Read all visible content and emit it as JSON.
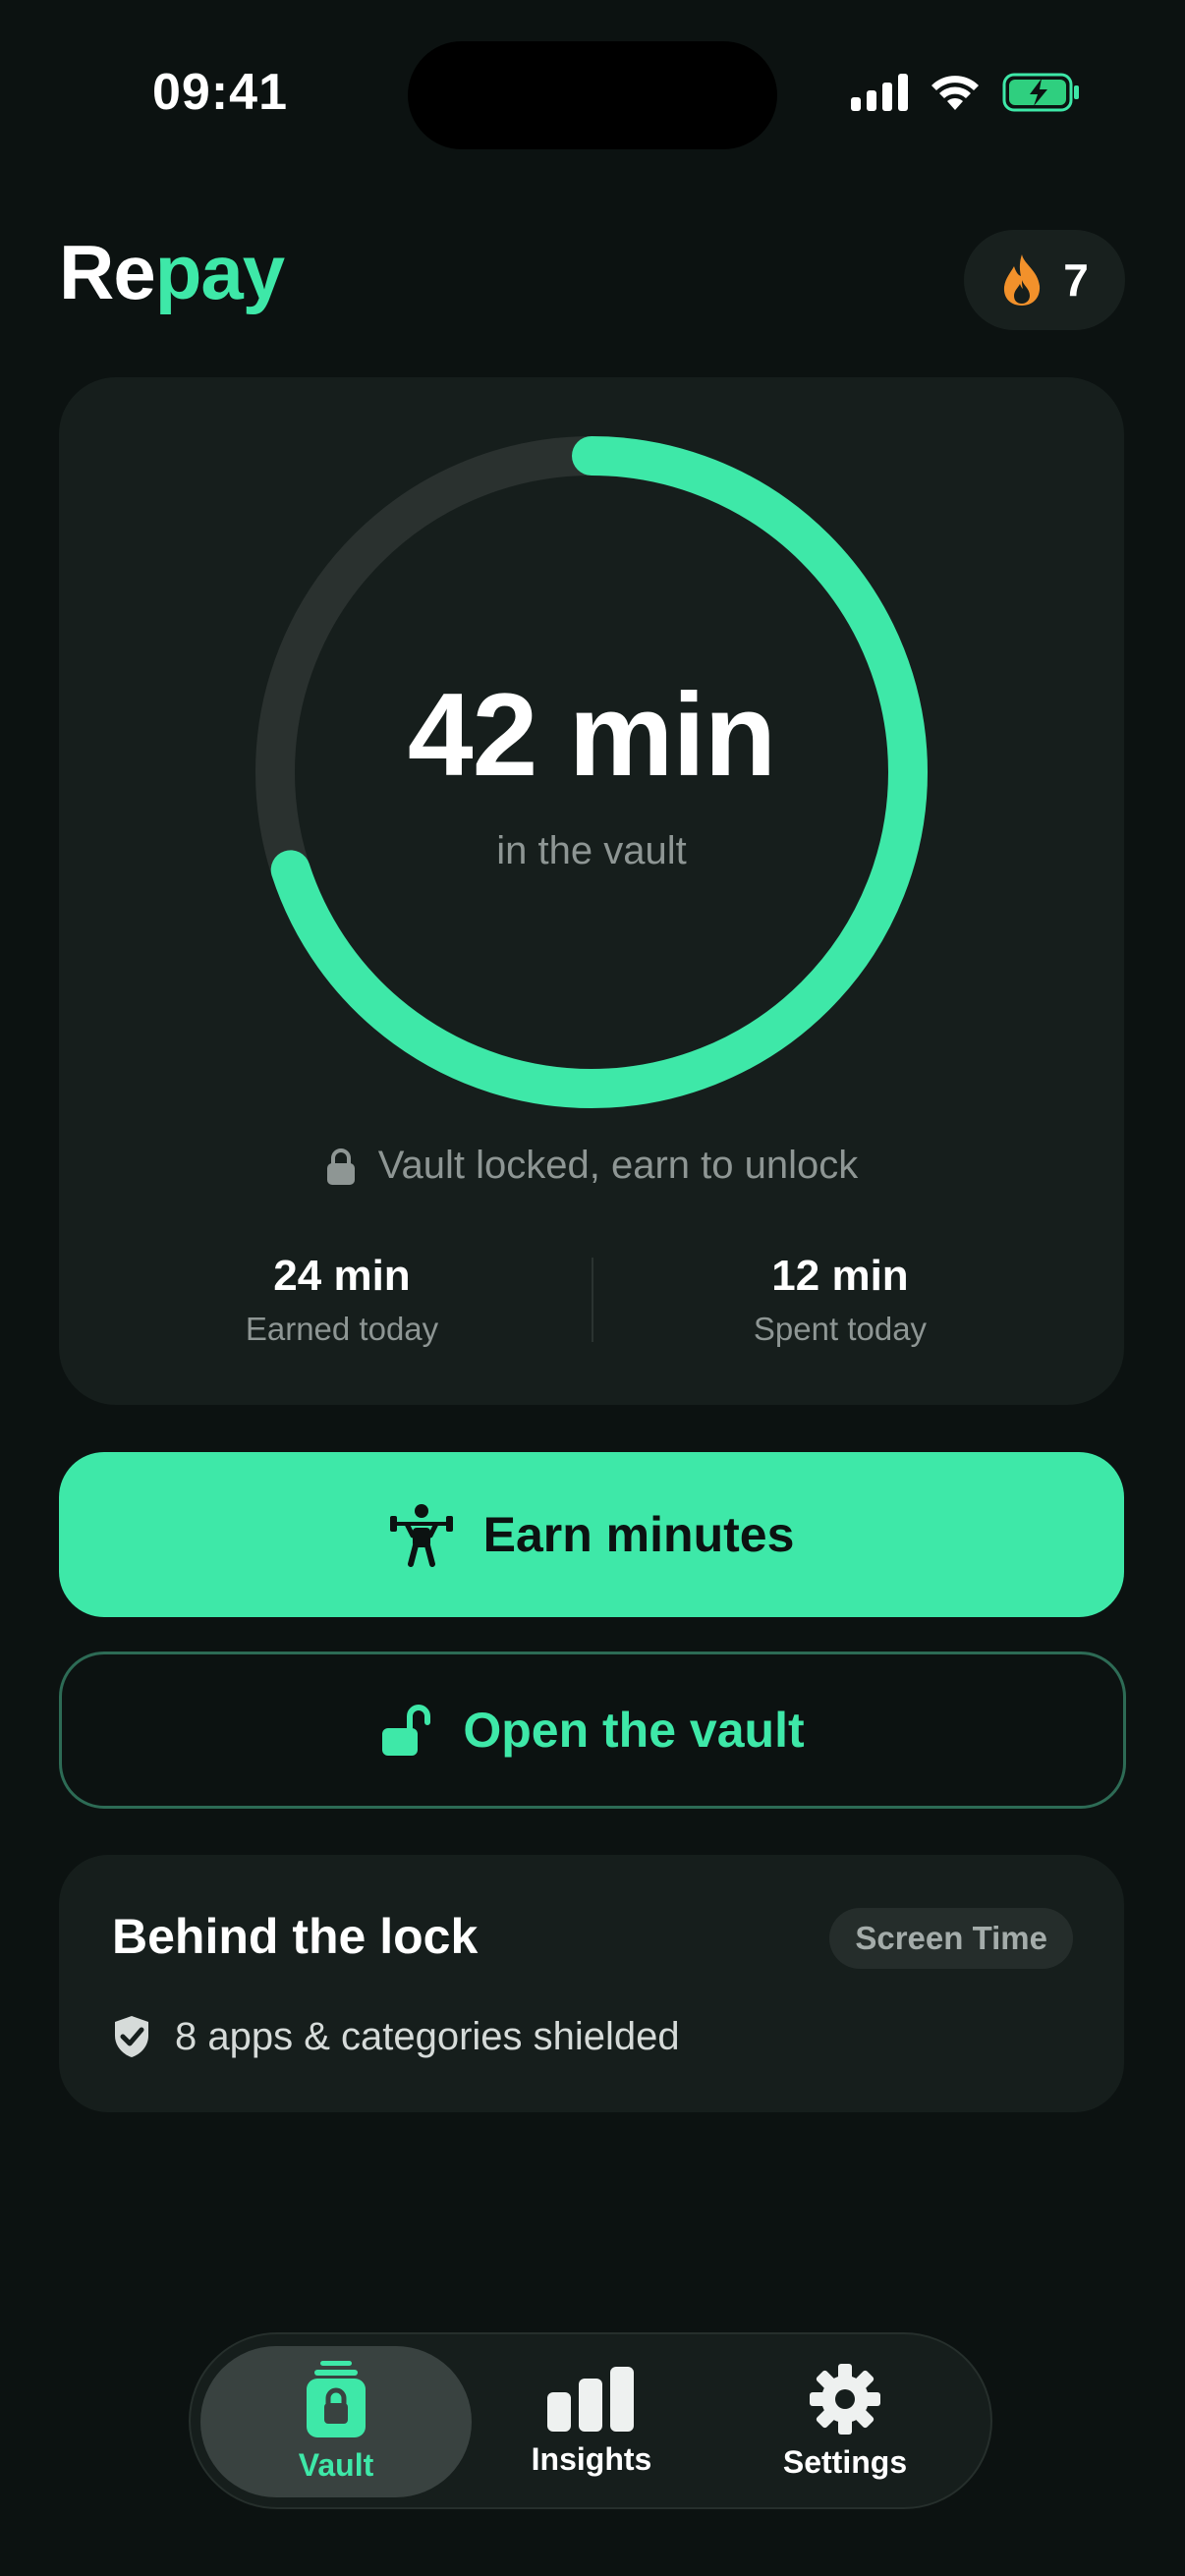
{
  "status_bar": {
    "time": "09:41"
  },
  "header": {
    "logo_part1": "Re",
    "logo_part2": "pay",
    "streak_count": "7",
    "streak_icon": "flame-icon"
  },
  "vault": {
    "value": "42 min",
    "subtitle": "in the vault",
    "progress_fraction": 0.7,
    "lock_status": "Vault locked, earn to unlock",
    "stats": [
      {
        "value": "24 min",
        "label": "Earned today"
      },
      {
        "value": "12 min",
        "label": "Spent today"
      }
    ]
  },
  "actions": {
    "earn_label": "Earn minutes",
    "open_label": "Open the vault"
  },
  "behind_lock": {
    "title": "Behind the lock",
    "badge": "Screen Time",
    "shield_text": "8 apps & categories shielded"
  },
  "tabbar": {
    "items": [
      {
        "label": "Vault",
        "icon": "vault-icon",
        "active": true
      },
      {
        "label": "Insights",
        "icon": "bar-chart-icon",
        "active": false
      },
      {
        "label": "Settings",
        "icon": "gear-icon",
        "active": false
      }
    ]
  },
  "colors": {
    "accent": "#3ee8a8",
    "background": "#0c1211",
    "card": "#161e1c",
    "muted_text": "#8e9694",
    "streak_orange": "#f2912b"
  }
}
